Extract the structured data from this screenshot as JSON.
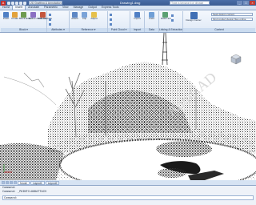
{
  "titlebar": {
    "workspace": "2D Drafting & Annotation",
    "document": "Drawing1.dwg",
    "search_placeholder": "Type a keyword or phrase",
    "minimize": "_",
    "maximize": "□",
    "close": "×"
  },
  "tabs": [
    {
      "label": "Home",
      "active": false
    },
    {
      "label": "Insert",
      "active": true
    },
    {
      "label": "Annotate",
      "active": false
    },
    {
      "label": "Parametric",
      "active": false
    },
    {
      "label": "View",
      "active": false
    },
    {
      "label": "Manage",
      "active": false
    },
    {
      "label": "Output",
      "active": false
    },
    {
      "label": "Express Tools",
      "active": false
    }
  ],
  "ribbon": {
    "block_panel": {
      "title": "Block ▾",
      "tools": [
        "Insert",
        "Create",
        "Block Editor",
        "Define Attributes",
        "Edit Attribute"
      ]
    },
    "attributes_panel": {
      "title": "Attributes ▾"
    },
    "reference_panel": {
      "title": "Reference ▾",
      "tools": [
        "Attach",
        "Clip",
        "Adjust"
      ]
    },
    "pointcloud_panel": {
      "title": "Point Cloud ▾"
    },
    "import_panel": {
      "title": "Import",
      "tools": [
        "Import"
      ]
    },
    "data_panel": {
      "title": "Data",
      "tools": [
        "Field"
      ]
    },
    "linking_panel": {
      "title": "Linking & Extraction",
      "tools": [
        "Data Link"
      ]
    },
    "content_panel": {
      "title": "Content",
      "tools": [
        "Design Center"
      ],
      "box1": "Seek design content",
      "box2": "Find product design files online"
    }
  },
  "viewport": {
    "watermark": "AutoCAD"
  },
  "layout_tabs": [
    {
      "label": "Model",
      "active": true
    },
    {
      "label": "Layout1",
      "active": false
    },
    {
      "label": "Layout2",
      "active": false
    }
  ],
  "command_line": {
    "line1": "Command:",
    "line2": "Command: _POINTCLOUDATTACH",
    "prompt": "Command:"
  },
  "colors": {
    "accent": "#3a5c92",
    "ribbon": "#dfe9f6",
    "canvas": "#ffffff"
  }
}
